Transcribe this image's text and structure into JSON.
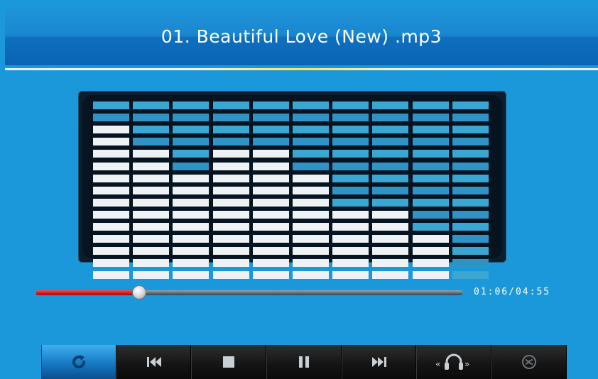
{
  "header": {
    "track_title": "01. Beautiful Love (New) .mp3"
  },
  "equalizer": {
    "bands": 10,
    "segments_per_band": 15,
    "levels": [
      13,
      11,
      9,
      11,
      11,
      9,
      6,
      6,
      4,
      0
    ],
    "colors": {
      "lit": "#eef2f4",
      "unlit": "#3aa6d2",
      "unlit_alt": "#2f93c6"
    }
  },
  "playback": {
    "progress_fraction": 0.225,
    "time_display": "01:06/04:55"
  },
  "controls": [
    {
      "name": "repeat-button",
      "icon": "repeat-icon",
      "active": true
    },
    {
      "name": "previous-button",
      "icon": "previous-icon",
      "active": false
    },
    {
      "name": "stop-button",
      "icon": "stop-icon",
      "active": false
    },
    {
      "name": "pause-button",
      "icon": "pause-icon",
      "active": false
    },
    {
      "name": "next-button",
      "icon": "next-icon",
      "active": false
    },
    {
      "name": "audio-output-button",
      "icon": "headphones-icon",
      "active": false
    },
    {
      "name": "shuffle-button",
      "icon": "shuffle-icon",
      "active": false
    }
  ],
  "theme": {
    "background": "#1a98da",
    "seek_fill": "#d31616"
  }
}
